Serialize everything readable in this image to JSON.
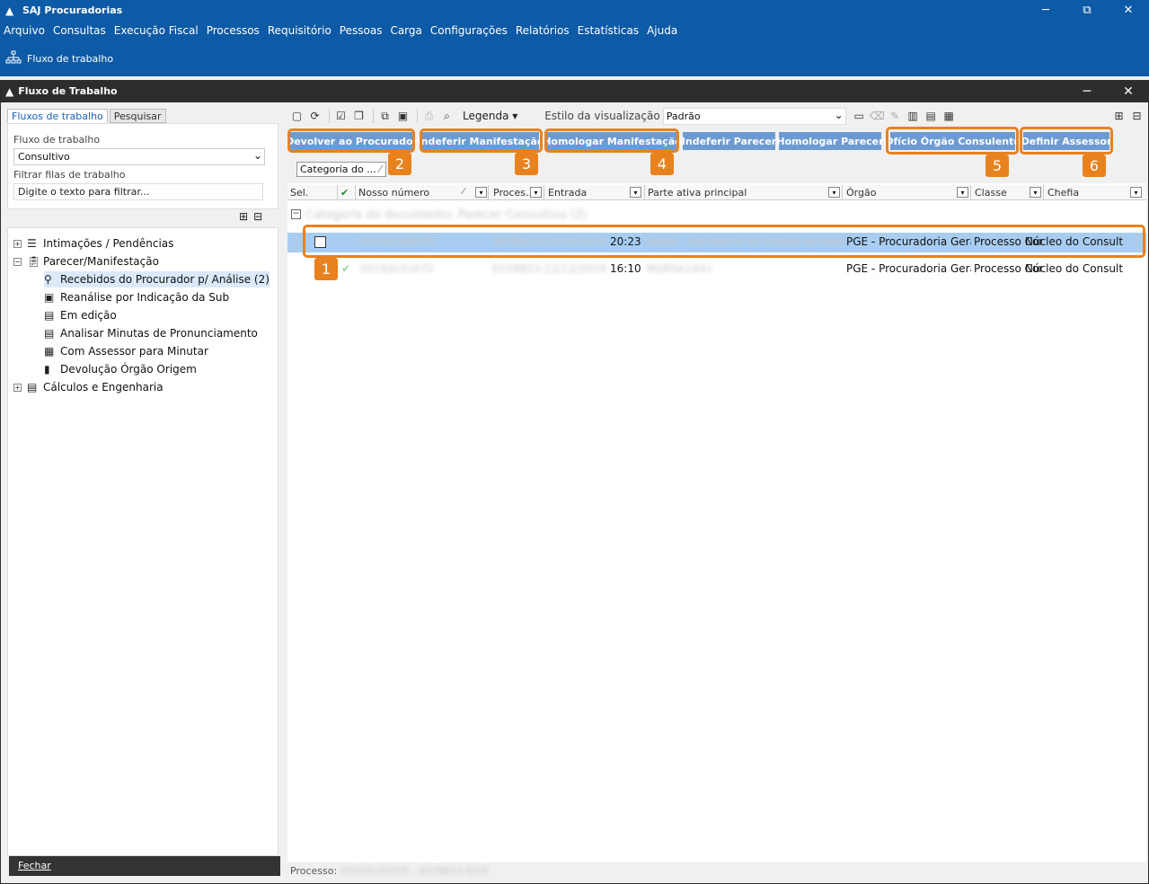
{
  "app": {
    "title": "SAJ Procuradorias",
    "minimize": "─",
    "restore": "⧉",
    "close": "✕"
  },
  "menu": [
    "Arquivo",
    "Consultas",
    "Execução Fiscal",
    "Processos",
    "Requisitório",
    "Pessoas",
    "Carga",
    "Configurações",
    "Relatórios",
    "Estatísticas",
    "Ajuda"
  ],
  "quickbar": {
    "label": "Fluxo de trabalho",
    "icon": "org-chart-icon"
  },
  "window": {
    "title": "Fluxo de Trabalho",
    "minimize": "─",
    "close": "✕"
  },
  "left": {
    "tabs": [
      "Fluxos de trabalho",
      "Pesquisar"
    ],
    "flow_label": "Fluxo de trabalho",
    "flow_value": "Consultivo",
    "filter_label": "Filtrar filas de trabalho",
    "filter_value": "Digite o texto para filtrar...",
    "tree": [
      {
        "label": "Intimações / Pendências",
        "expander": "+",
        "icon": "stack-icon"
      },
      {
        "label": "Parecer/Manifestação",
        "expander": "−",
        "icon": "clipboard-icon"
      },
      {
        "label": "Recebidos do Procurador p/  Análise (2)",
        "icon": "person-icon"
      },
      {
        "label": "Reanálise por Indicação da Sub",
        "icon": "document-m-icon"
      },
      {
        "label": "Em edição",
        "icon": "clipboard-icon"
      },
      {
        "label": "Analisar Minutas de Pronunciamento",
        "icon": "clipboard-icon"
      },
      {
        "label": "Com Assessor para Minutar",
        "icon": "list-icon"
      },
      {
        "label": "Devolução Órgão Origem",
        "icon": "document-return-icon"
      },
      {
        "label": "Cálculos e Engenharia",
        "expander": "+",
        "icon": "clipboard-icon"
      }
    ],
    "close_button": "Fechar"
  },
  "toolbar": {
    "legenda": "Legenda",
    "estilo_label": "Estilo da visualização",
    "estilo_value": "Padrão"
  },
  "actions": [
    {
      "label": "Devolver ao Procurador",
      "badge": "2"
    },
    {
      "label": "Indeferir Manifestação",
      "badge": "3"
    },
    {
      "label": "Homologar Manifestação",
      "badge": "4"
    },
    {
      "label": "Indeferir Parecer"
    },
    {
      "label": "Homologar Parecer"
    },
    {
      "label": "Ofício Órgão Consulente",
      "badge": "5"
    },
    {
      "label": "Definir Assessor",
      "badge": "6"
    }
  ],
  "grid": {
    "group_by": "Categoria do ...",
    "columns": [
      "Sel.",
      "Nosso número",
      "Proces...",
      "Entrada",
      "Parte ativa principal",
      "Órgão",
      "Classe",
      "Chefia"
    ],
    "group_label": "Categoria do documento: Parecer Consultivo (2)",
    "rows": [
      {
        "nosso": "20192L00078",
        "proc": "0078623-25/10/2020",
        "entrada": "20:23",
        "parte": "Seller - Secretaria do Estado de Fazend",
        "orgao": "PGE - Procuradoria Gera",
        "classe": "Processo Cor",
        "chefia": "Núcleo do Consult",
        "badge": "1"
      },
      {
        "nosso": "20192L01672",
        "proc": "0158823-22/12/2019",
        "entrada": "16:10",
        "parte": "NGRSA1441",
        "orgao": "PGE - Procuradoria Gera",
        "classe": "Processo Cor",
        "chefia": "Núcleo do Consult"
      }
    ]
  },
  "status": {
    "label": "Processo:",
    "value": "20192L00078 - 0078623-8/19"
  },
  "colors": {
    "app_blue": "#0d5aa6",
    "inner_title": "#2d2d30",
    "button_blue": "#6d9bd1",
    "highlight_orange": "#e8821e",
    "selected_row": "#a8cdf0"
  }
}
